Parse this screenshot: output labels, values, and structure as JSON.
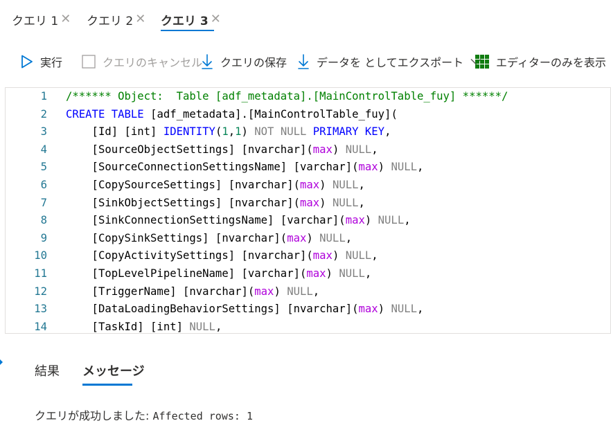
{
  "query_tabs": [
    {
      "label": "クエリ 1",
      "active": false
    },
    {
      "label": "クエリ 2",
      "active": false
    },
    {
      "label": "クエリ 3",
      "active": true
    }
  ],
  "toolbar": {
    "run_label": "実行",
    "cancel_label": "クエリのキャンセル",
    "save_label": "クエリの保存",
    "export_label": "データを としてエクスポート",
    "editor_only_label": "エディターのみを表示"
  },
  "editor": {
    "line_numbers": [
      "1",
      "2",
      "3",
      "4",
      "5",
      "6",
      "7",
      "8",
      "9",
      "10",
      "11",
      "12",
      "13",
      "14"
    ],
    "lines": [
      [
        {
          "t": "/****** Object:  Table [adf_metadata].[MainControlTable_fuy] ******/",
          "c": "comment"
        }
      ],
      [
        {
          "t": "CREATE",
          "c": "kw"
        },
        {
          "t": " ",
          "c": "text"
        },
        {
          "t": "TABLE",
          "c": "kw"
        },
        {
          "t": " [adf_metadata].[MainControlTable_fuy](",
          "c": "text"
        }
      ],
      [
        {
          "t": "    [Id] [int] ",
          "c": "text"
        },
        {
          "t": "IDENTITY",
          "c": "kw"
        },
        {
          "t": "(",
          "c": "text"
        },
        {
          "t": "1",
          "c": "num"
        },
        {
          "t": ",",
          "c": "text"
        },
        {
          "t": "1",
          "c": "num"
        },
        {
          "t": ") ",
          "c": "text"
        },
        {
          "t": "NOT NULL",
          "c": "null"
        },
        {
          "t": " ",
          "c": "text"
        },
        {
          "t": "PRIMARY KEY",
          "c": "kw"
        },
        {
          "t": ",",
          "c": "text"
        }
      ],
      [
        {
          "t": "    [SourceObjectSettings] [nvarchar](",
          "c": "text"
        },
        {
          "t": "max",
          "c": "max"
        },
        {
          "t": ") ",
          "c": "text"
        },
        {
          "t": "NULL",
          "c": "null"
        },
        {
          "t": ",",
          "c": "text"
        }
      ],
      [
        {
          "t": "    [SourceConnectionSettingsName] [varchar](",
          "c": "text"
        },
        {
          "t": "max",
          "c": "max"
        },
        {
          "t": ") ",
          "c": "text"
        },
        {
          "t": "NULL",
          "c": "null"
        },
        {
          "t": ",",
          "c": "text"
        }
      ],
      [
        {
          "t": "    [CopySourceSettings] [nvarchar](",
          "c": "text"
        },
        {
          "t": "max",
          "c": "max"
        },
        {
          "t": ") ",
          "c": "text"
        },
        {
          "t": "NULL",
          "c": "null"
        },
        {
          "t": ",",
          "c": "text"
        }
      ],
      [
        {
          "t": "    [SinkObjectSettings] [nvarchar](",
          "c": "text"
        },
        {
          "t": "max",
          "c": "max"
        },
        {
          "t": ") ",
          "c": "text"
        },
        {
          "t": "NULL",
          "c": "null"
        },
        {
          "t": ",",
          "c": "text"
        }
      ],
      [
        {
          "t": "    [SinkConnectionSettingsName] [varchar](",
          "c": "text"
        },
        {
          "t": "max",
          "c": "max"
        },
        {
          "t": ") ",
          "c": "text"
        },
        {
          "t": "NULL",
          "c": "null"
        },
        {
          "t": ",",
          "c": "text"
        }
      ],
      [
        {
          "t": "    [CopySinkSettings] [nvarchar](",
          "c": "text"
        },
        {
          "t": "max",
          "c": "max"
        },
        {
          "t": ") ",
          "c": "text"
        },
        {
          "t": "NULL",
          "c": "null"
        },
        {
          "t": ",",
          "c": "text"
        }
      ],
      [
        {
          "t": "    [CopyActivitySettings] [nvarchar](",
          "c": "text"
        },
        {
          "t": "max",
          "c": "max"
        },
        {
          "t": ") ",
          "c": "text"
        },
        {
          "t": "NULL",
          "c": "null"
        },
        {
          "t": ",",
          "c": "text"
        }
      ],
      [
        {
          "t": "    [TopLevelPipelineName] [varchar](",
          "c": "text"
        },
        {
          "t": "max",
          "c": "max"
        },
        {
          "t": ") ",
          "c": "text"
        },
        {
          "t": "NULL",
          "c": "null"
        },
        {
          "t": ",",
          "c": "text"
        }
      ],
      [
        {
          "t": "    [TriggerName] [nvarchar](",
          "c": "text"
        },
        {
          "t": "max",
          "c": "max"
        },
        {
          "t": ") ",
          "c": "text"
        },
        {
          "t": "NULL",
          "c": "null"
        },
        {
          "t": ",",
          "c": "text"
        }
      ],
      [
        {
          "t": "    [DataLoadingBehaviorSettings] [nvarchar](",
          "c": "text"
        },
        {
          "t": "max",
          "c": "max"
        },
        {
          "t": ") ",
          "c": "text"
        },
        {
          "t": "NULL",
          "c": "null"
        },
        {
          "t": ",",
          "c": "text"
        }
      ],
      [
        {
          "t": "    [TaskId] [int] ",
          "c": "text"
        },
        {
          "t": "NULL",
          "c": "null"
        },
        {
          "t": ",",
          "c": "text"
        }
      ]
    ]
  },
  "results": {
    "tabs": [
      {
        "label": "結果",
        "active": false
      },
      {
        "label": "メッセージ",
        "active": true
      }
    ],
    "message_prefix": "クエリが成功しました: ",
    "message_detail": "Affected rows: 1"
  },
  "colors": {
    "accent": "#0078d4",
    "comment": "#008000",
    "keyword": "#0000ff",
    "max": "#af00db",
    "null": "#808080",
    "line_number": "#237893",
    "grid_icon": "#107c10"
  },
  "icons": {
    "run": "play-icon",
    "cancel": "checkbox-icon",
    "save": "download-arrow-icon",
    "export": "download-arrow-icon",
    "export_dropdown": "chevron-down-icon",
    "editor_only": "grid-icon"
  }
}
